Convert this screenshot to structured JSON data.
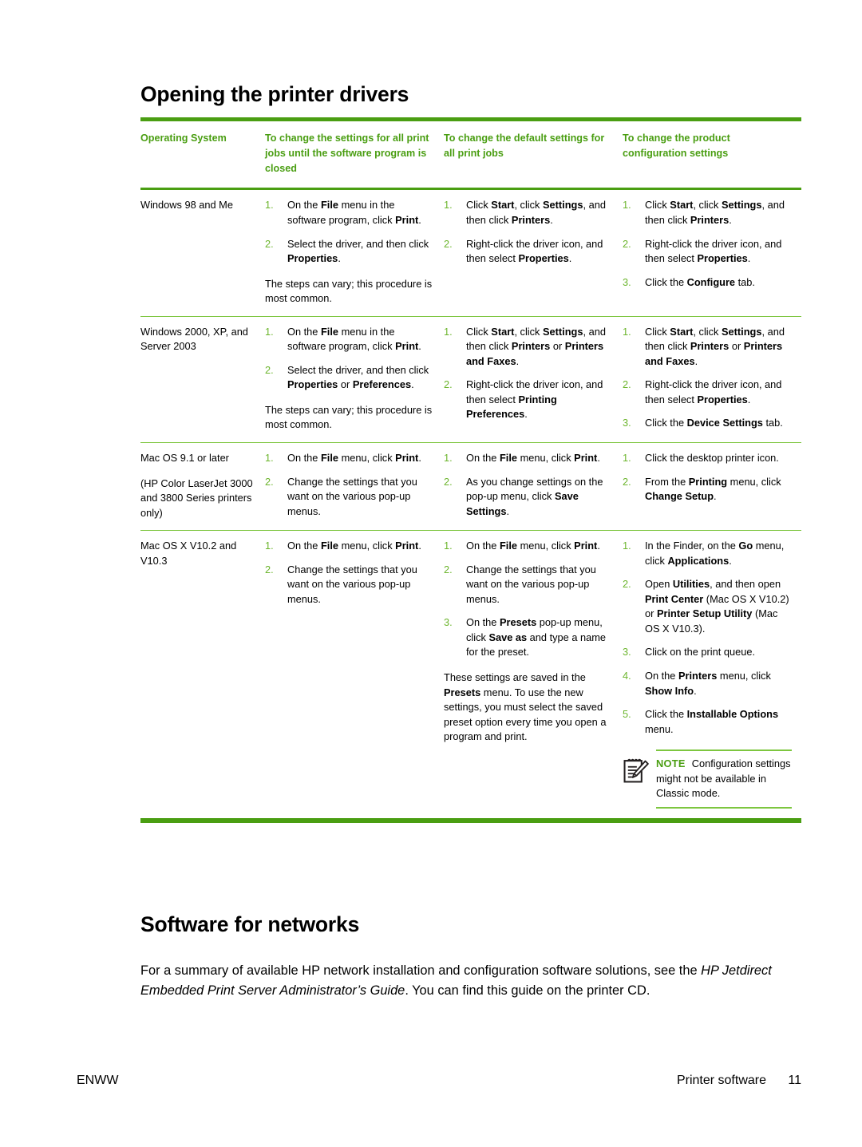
{
  "page": {
    "heading_drivers": "Opening the printer drivers",
    "heading_networks": "Software for networks",
    "body_paragraph_pre": "For a summary of available HP network installation and configuration software solutions, see the ",
    "body_paragraph_italic": "HP Jetdirect Embedded Print Server Administrator’s Guide",
    "body_paragraph_post": ". You can find this guide on the printer CD."
  },
  "table": {
    "headers": [
      "Operating System",
      "To change the settings for all print jobs until the software program is closed",
      "To change the default settings for all print jobs",
      "To change the product configuration settings"
    ],
    "rows": [
      {
        "os": [
          "Windows 98 and Me"
        ],
        "col2": {
          "steps": [
            {
              "parts": [
                {
                  "t": "On the ",
                  "b": false
                },
                {
                  "t": "File",
                  "b": true
                },
                {
                  "t": " menu in the software program, click ",
                  "b": false
                },
                {
                  "t": "Print",
                  "b": true
                },
                {
                  "t": ".",
                  "b": false
                }
              ]
            },
            {
              "parts": [
                {
                  "t": "Select the driver, and then click ",
                  "b": false
                },
                {
                  "t": "Properties",
                  "b": true
                },
                {
                  "t": ".",
                  "b": false
                }
              ]
            }
          ],
          "trailing": "The steps can vary; this procedure is most common."
        },
        "col3": {
          "steps": [
            {
              "parts": [
                {
                  "t": "Click ",
                  "b": false
                },
                {
                  "t": "Start",
                  "b": true
                },
                {
                  "t": ", click ",
                  "b": false
                },
                {
                  "t": "Settings",
                  "b": true
                },
                {
                  "t": ", and then click ",
                  "b": false
                },
                {
                  "t": "Printers",
                  "b": true
                },
                {
                  "t": ".",
                  "b": false
                }
              ]
            },
            {
              "parts": [
                {
                  "t": "Right-click the driver icon, and then select ",
                  "b": false
                },
                {
                  "t": "Properties",
                  "b": true
                },
                {
                  "t": ".",
                  "b": false
                }
              ]
            }
          ],
          "trailing": ""
        },
        "col4": {
          "steps": [
            {
              "parts": [
                {
                  "t": "Click ",
                  "b": false
                },
                {
                  "t": "Start",
                  "b": true
                },
                {
                  "t": ", click ",
                  "b": false
                },
                {
                  "t": "Settings",
                  "b": true
                },
                {
                  "t": ", and then click ",
                  "b": false
                },
                {
                  "t": "Printers",
                  "b": true
                },
                {
                  "t": ".",
                  "b": false
                }
              ]
            },
            {
              "parts": [
                {
                  "t": "Right-click the driver icon, and then select ",
                  "b": false
                },
                {
                  "t": "Properties",
                  "b": true
                },
                {
                  "t": ".",
                  "b": false
                }
              ]
            },
            {
              "parts": [
                {
                  "t": "Click the ",
                  "b": false
                },
                {
                  "t": "Configure",
                  "b": true
                },
                {
                  "t": " tab.",
                  "b": false
                }
              ]
            }
          ],
          "trailing": ""
        }
      },
      {
        "os": [
          "Windows 2000, XP, and Server 2003"
        ],
        "col2": {
          "steps": [
            {
              "parts": [
                {
                  "t": "On the ",
                  "b": false
                },
                {
                  "t": "File",
                  "b": true
                },
                {
                  "t": " menu in the software program, click ",
                  "b": false
                },
                {
                  "t": "Print",
                  "b": true
                },
                {
                  "t": ".",
                  "b": false
                }
              ]
            },
            {
              "parts": [
                {
                  "t": "Select the driver, and then click ",
                  "b": false
                },
                {
                  "t": "Properties",
                  "b": true
                },
                {
                  "t": " or ",
                  "b": false
                },
                {
                  "t": "Preferences",
                  "b": true
                },
                {
                  "t": ".",
                  "b": false
                }
              ]
            }
          ],
          "trailing": "The steps can vary; this procedure is most common."
        },
        "col3": {
          "steps": [
            {
              "parts": [
                {
                  "t": "Click ",
                  "b": false
                },
                {
                  "t": "Start",
                  "b": true
                },
                {
                  "t": ", click ",
                  "b": false
                },
                {
                  "t": "Settings",
                  "b": true
                },
                {
                  "t": ", and then click ",
                  "b": false
                },
                {
                  "t": "Printers",
                  "b": true
                },
                {
                  "t": " or ",
                  "b": false
                },
                {
                  "t": "Printers and Faxes",
                  "b": true
                },
                {
                  "t": ".",
                  "b": false
                }
              ]
            },
            {
              "parts": [
                {
                  "t": "Right-click the driver icon, and then select ",
                  "b": false
                },
                {
                  "t": "Printing Preferences",
                  "b": true
                },
                {
                  "t": ".",
                  "b": false
                }
              ]
            }
          ],
          "trailing": ""
        },
        "col4": {
          "steps": [
            {
              "parts": [
                {
                  "t": "Click ",
                  "b": false
                },
                {
                  "t": "Start",
                  "b": true
                },
                {
                  "t": ", click ",
                  "b": false
                },
                {
                  "t": "Settings",
                  "b": true
                },
                {
                  "t": ", and then click ",
                  "b": false
                },
                {
                  "t": "Printers",
                  "b": true
                },
                {
                  "t": " or ",
                  "b": false
                },
                {
                  "t": "Printers and Faxes",
                  "b": true
                },
                {
                  "t": ".",
                  "b": false
                }
              ]
            },
            {
              "parts": [
                {
                  "t": "Right-click the driver icon, and then select ",
                  "b": false
                },
                {
                  "t": "Properties",
                  "b": true
                },
                {
                  "t": ".",
                  "b": false
                }
              ]
            },
            {
              "parts": [
                {
                  "t": "Click the ",
                  "b": false
                },
                {
                  "t": "Device Settings",
                  "b": true
                },
                {
                  "t": " tab.",
                  "b": false
                }
              ]
            }
          ],
          "trailing": ""
        }
      },
      {
        "os": [
          "Mac OS 9.1 or later",
          "(HP Color LaserJet 3000 and 3800 Series printers only)"
        ],
        "col2": {
          "steps": [
            {
              "parts": [
                {
                  "t": "On the ",
                  "b": false
                },
                {
                  "t": "File",
                  "b": true
                },
                {
                  "t": " menu, click ",
                  "b": false
                },
                {
                  "t": "Print",
                  "b": true
                },
                {
                  "t": ".",
                  "b": false
                }
              ]
            },
            {
              "parts": [
                {
                  "t": "Change the settings that you want on the various pop-up menus.",
                  "b": false
                }
              ]
            }
          ],
          "trailing": ""
        },
        "col3": {
          "steps": [
            {
              "parts": [
                {
                  "t": "On the ",
                  "b": false
                },
                {
                  "t": "File",
                  "b": true
                },
                {
                  "t": " menu, click ",
                  "b": false
                },
                {
                  "t": "Print",
                  "b": true
                },
                {
                  "t": ".",
                  "b": false
                }
              ]
            },
            {
              "parts": [
                {
                  "t": "As you change settings on the pop-up menu, click ",
                  "b": false
                },
                {
                  "t": "Save Settings",
                  "b": true
                },
                {
                  "t": ".",
                  "b": false
                }
              ]
            }
          ],
          "trailing": ""
        },
        "col4": {
          "steps": [
            {
              "parts": [
                {
                  "t": "Click the desktop printer icon.",
                  "b": false
                }
              ]
            },
            {
              "parts": [
                {
                  "t": "From the ",
                  "b": false
                },
                {
                  "t": "Printing",
                  "b": true
                },
                {
                  "t": " menu, click ",
                  "b": false
                },
                {
                  "t": "Change Setup",
                  "b": true
                },
                {
                  "t": ".",
                  "b": false
                }
              ]
            }
          ],
          "trailing": ""
        }
      },
      {
        "os": [
          "Mac OS X V10.2 and V10.3"
        ],
        "col2": {
          "steps": [
            {
              "parts": [
                {
                  "t": "On the ",
                  "b": false
                },
                {
                  "t": "File",
                  "b": true
                },
                {
                  "t": " menu, click ",
                  "b": false
                },
                {
                  "t": "Print",
                  "b": true
                },
                {
                  "t": ".",
                  "b": false
                }
              ]
            },
            {
              "parts": [
                {
                  "t": "Change the settings that you want on the various pop-up menus.",
                  "b": false
                }
              ]
            }
          ],
          "trailing": ""
        },
        "col3": {
          "steps": [
            {
              "parts": [
                {
                  "t": "On the ",
                  "b": false
                },
                {
                  "t": "File",
                  "b": true
                },
                {
                  "t": " menu, click ",
                  "b": false
                },
                {
                  "t": "Print",
                  "b": true
                },
                {
                  "t": ".",
                  "b": false
                }
              ]
            },
            {
              "parts": [
                {
                  "t": "Change the settings that you want on the various pop-up menus.",
                  "b": false
                }
              ]
            },
            {
              "parts": [
                {
                  "t": "On the ",
                  "b": false
                },
                {
                  "t": "Presets",
                  "b": true
                },
                {
                  "t": " pop-up menu, click ",
                  "b": false
                },
                {
                  "t": "Save as",
                  "b": true
                },
                {
                  "t": " and type a name for the preset.",
                  "b": false
                }
              ]
            }
          ],
          "trailing_parts": [
            {
              "t": "These settings are saved in the ",
              "b": false
            },
            {
              "t": "Presets",
              "b": true
            },
            {
              "t": " menu. To use the new settings, you must select the saved preset option every time you open a program and print.",
              "b": false
            }
          ]
        },
        "col4": {
          "steps": [
            {
              "parts": [
                {
                  "t": "In the Finder, on the ",
                  "b": false
                },
                {
                  "t": "Go",
                  "b": true
                },
                {
                  "t": " menu, click ",
                  "b": false
                },
                {
                  "t": "Applications",
                  "b": true
                },
                {
                  "t": ".",
                  "b": false
                }
              ]
            },
            {
              "parts": [
                {
                  "t": "Open ",
                  "b": false
                },
                {
                  "t": "Utilities",
                  "b": true
                },
                {
                  "t": ", and then open ",
                  "b": false
                },
                {
                  "t": "Print Center",
                  "b": true
                },
                {
                  "t": " (Mac OS X V10.2) or ",
                  "b": false
                },
                {
                  "t": "Printer Setup Utility",
                  "b": true
                },
                {
                  "t": " (Mac OS X V10.3).",
                  "b": false
                }
              ]
            },
            {
              "parts": [
                {
                  "t": "Click on the print queue.",
                  "b": false
                }
              ]
            },
            {
              "parts": [
                {
                  "t": "On the ",
                  "b": false
                },
                {
                  "t": "Printers",
                  "b": true
                },
                {
                  "t": " menu, click ",
                  "b": false
                },
                {
                  "t": "Show Info",
                  "b": true
                },
                {
                  "t": ".",
                  "b": false
                }
              ]
            },
            {
              "parts": [
                {
                  "t": "Click the ",
                  "b": false
                },
                {
                  "t": "Installable Options",
                  "b": true
                },
                {
                  "t": " menu.",
                  "b": false
                }
              ]
            }
          ],
          "trailing": "",
          "note": {
            "icon": "note-pad-pencil-icon",
            "label": "NOTE",
            "text": "Configuration settings might not be available in Classic mode."
          }
        }
      }
    ]
  },
  "footer": {
    "left": "ENWW",
    "section": "Printer software",
    "page_number": "11"
  },
  "colors": {
    "accent_green": "#4a9e12",
    "rule_light_green": "#7dc63f",
    "list_number_green": "#6cb52d",
    "text_black": "#000000"
  }
}
